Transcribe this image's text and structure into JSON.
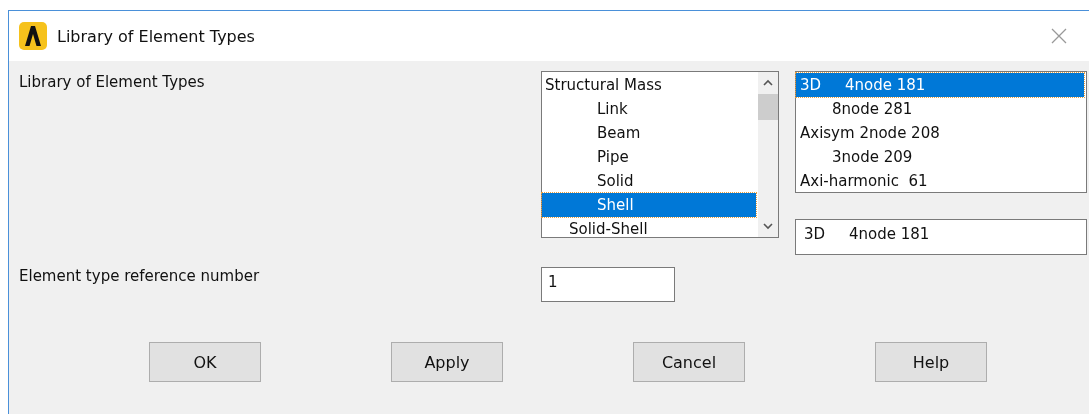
{
  "window": {
    "title": "Library of Element Types"
  },
  "library_label": "Library of Element Types",
  "categories": [
    {
      "text": "Structural Mass",
      "kind": "group",
      "selected": false
    },
    {
      "text": "Link",
      "kind": "item",
      "selected": false
    },
    {
      "text": "Beam",
      "kind": "item",
      "selected": false
    },
    {
      "text": "Pipe",
      "kind": "item",
      "selected": false
    },
    {
      "text": "Solid",
      "kind": "item",
      "selected": false
    },
    {
      "text": "Shell",
      "kind": "item",
      "selected": true
    },
    {
      "text": "Solid-Shell",
      "kind": "subgroup",
      "selected": false
    }
  ],
  "element_types": [
    {
      "text": "3D     4node 181",
      "kind": "first",
      "selected": true
    },
    {
      "text": "8node 281",
      "kind": "continued",
      "selected": false
    },
    {
      "text": "Axisym 2node 208",
      "kind": "first",
      "selected": false
    },
    {
      "text": "3node 209",
      "kind": "continued",
      "selected": false
    },
    {
      "text": "Axi-harmonic  61",
      "kind": "first",
      "selected": false
    }
  ],
  "selection_value": "3D     4node 181",
  "reference_label": "Element type reference number",
  "reference_value": "1",
  "buttons": [
    "OK",
    "Apply",
    "Cancel",
    "Help"
  ]
}
